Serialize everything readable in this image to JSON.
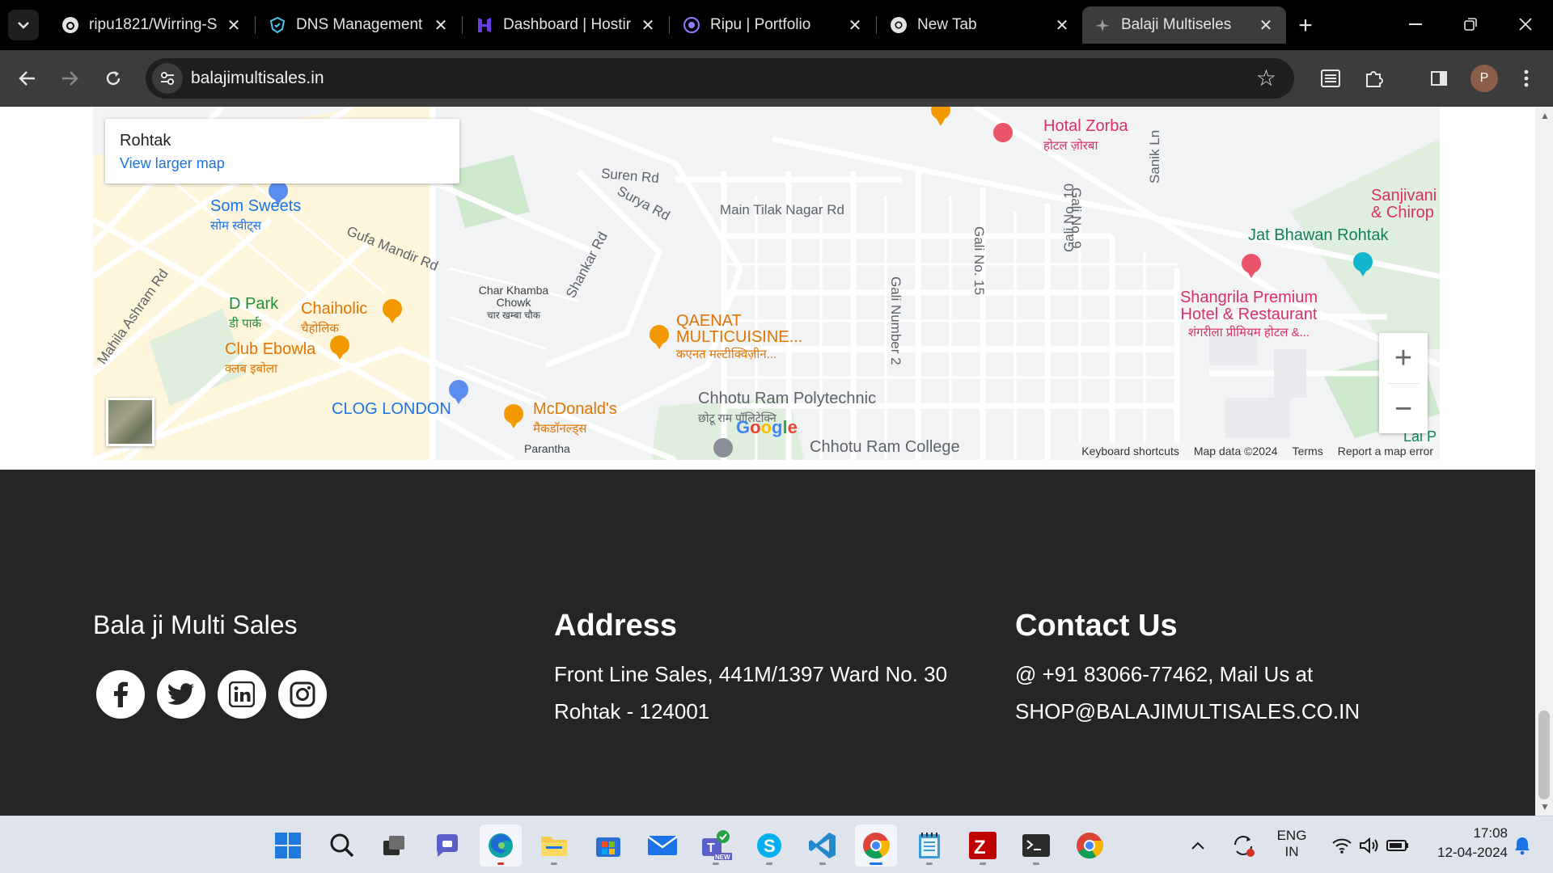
{
  "browser": {
    "tabs": [
      {
        "title": "ripu1821/Wirring-S",
        "icon": "github-icon",
        "active": false
      },
      {
        "title": "DNS Management",
        "icon": "dns-icon",
        "active": false
      },
      {
        "title": "Dashboard | Hostir",
        "icon": "hostinger-icon",
        "active": false
      },
      {
        "title": "Ripu | Portfolio",
        "icon": "portfolio-icon",
        "active": false
      },
      {
        "title": "New Tab",
        "icon": "chrome-icon",
        "active": false
      },
      {
        "title": "Balaji Multiseles",
        "icon": "site-icon",
        "active": true
      }
    ],
    "url": "balajimultisales.in",
    "profile_initial": "P"
  },
  "map": {
    "place_name": "Rohtak",
    "view_larger": "View larger map",
    "labels": [
      {
        "text": "Som Sweets",
        "sub": "सोम स्वीट्स",
        "color": "#1a73e8"
      },
      {
        "text": "Gufa Mandir Rd",
        "sub": "",
        "color": "#5f6368"
      },
      {
        "text": "D Park",
        "sub": "डी पार्क",
        "color": "#1e8e3e"
      },
      {
        "text": "Chaiholic",
        "sub": "चैहोलिक",
        "color": "#e37400"
      },
      {
        "text": "Club Ebowla",
        "sub": "क्लब इबोला",
        "color": "#e37400"
      },
      {
        "text": "CLOG LONDON",
        "sub": "",
        "color": "#1a73e8"
      },
      {
        "text": "McDonald's",
        "sub": "मैकडॉनल्ड्स",
        "color": "#e37400"
      },
      {
        "text": "QAENAT MULTICUISINE...",
        "sub": "कएनत मल्टीक्विज़ीन...",
        "color": "#e37400"
      },
      {
        "text": "Chhotu Ram Polytechnic",
        "sub": "छोटू राम पॉलिटेक्नि",
        "color": "#5f6368"
      },
      {
        "text": "Chhotu Ram College",
        "sub": "",
        "color": "#5f6368"
      },
      {
        "text": "Hotal Zorba",
        "sub": "होटल ज़ोरबा",
        "color": "#d93064"
      },
      {
        "text": "Jat Bhawan Rohtak",
        "sub": "",
        "color": "#12805c"
      },
      {
        "text": "Shangrila Premium Hotel & Restaurant",
        "sub": "शंगरीला प्रीमियम होटल &...",
        "color": "#d93064"
      },
      {
        "text": "Sanjivani & Chirop",
        "sub": "",
        "color": "#d93064"
      },
      {
        "text": "Char Khamba Chowk",
        "sub": "चार खम्बा चौक",
        "color": "#3c4043"
      },
      {
        "text": "Main Tilak Nagar Rd",
        "sub": "",
        "color": "#5f6368"
      },
      {
        "text": "Suren Rd",
        "sub": "",
        "color": "#5f6368"
      },
      {
        "text": "Surya Rd",
        "sub": "",
        "color": "#5f6368"
      },
      {
        "text": "Shankar Rd",
        "sub": "",
        "color": "#5f6368"
      },
      {
        "text": "Mahila Ashram Rd",
        "sub": "",
        "color": "#5f6368"
      },
      {
        "text": "Gali Number 2",
        "sub": "",
        "color": "#5f6368"
      },
      {
        "text": "Gali No. 15",
        "sub": "",
        "color": "#5f6368"
      },
      {
        "text": "Gali No. 10",
        "sub": "",
        "color": "#5f6368"
      },
      {
        "text": "Gali No. 9",
        "sub": "",
        "color": "#5f6368"
      },
      {
        "text": "Sanik Ln",
        "sub": "",
        "color": "#5f6368"
      },
      {
        "text": "Parantha",
        "sub": "",
        "color": "#3c4043"
      },
      {
        "text": "Lal P",
        "sub": "",
        "color": "#12805c"
      }
    ],
    "google_logo": "Google",
    "footer": [
      "Keyboard shortcuts",
      "Map data ©2024",
      "Terms",
      "Report a map error"
    ]
  },
  "footer": {
    "brand": "Bala ji Multi Sales",
    "social": [
      "facebook-icon",
      "twitter-icon",
      "linkedin-icon",
      "instagram-icon"
    ],
    "address_title": "Address",
    "address_line1": "Front Line Sales, 441M/1397 Ward No. 30",
    "address_line2": "Rohtak - 124001",
    "contact_title": "Contact Us",
    "contact_line1": "@ +91 83066-77462, Mail Us at",
    "contact_line2": "SHOP@BALAJIMULTISALES.CO.IN"
  },
  "taskbar": {
    "lang_line1": "ENG",
    "lang_line2": "IN",
    "time": "17:08",
    "date": "12-04-2024"
  },
  "colors": {
    "footer_bg": "#252527",
    "accent": "#1a73e8"
  }
}
